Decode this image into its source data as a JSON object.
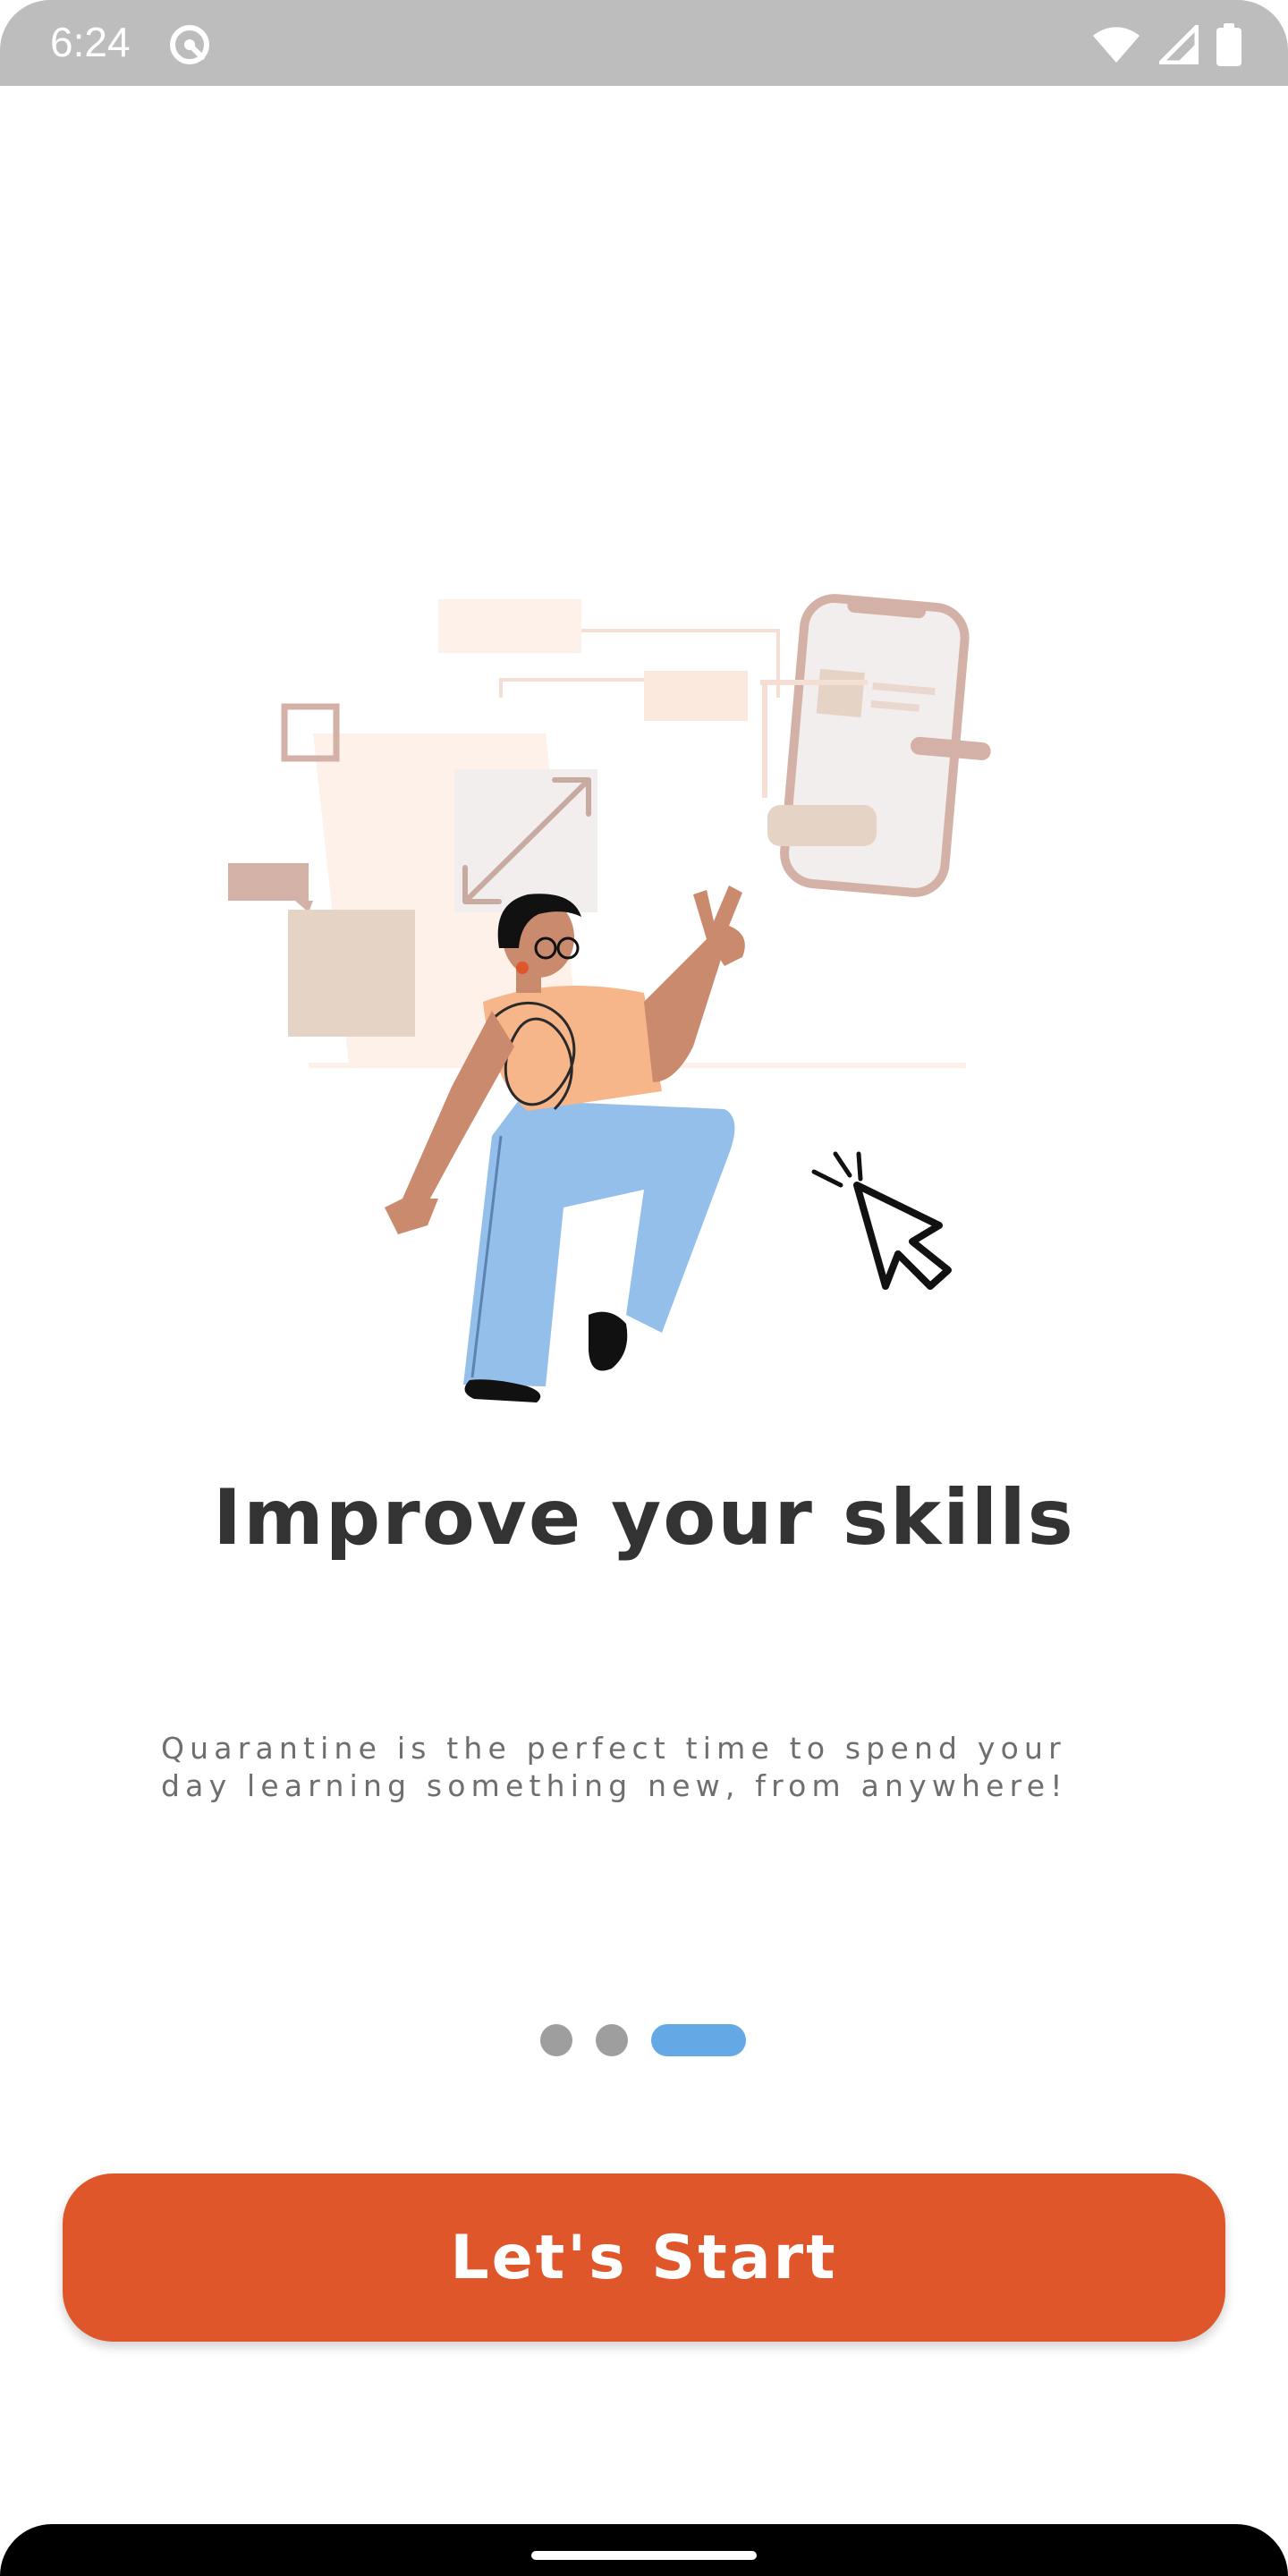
{
  "status_bar": {
    "time": "6:24",
    "icons": [
      "app-notification-icon",
      "wifi-icon",
      "cellular-signal-icon",
      "battery-icon"
    ]
  },
  "onboarding": {
    "illustration": "person-clicking-illustration",
    "title": "Improve your skills",
    "description": "Quarantine is the perfect time to spend your day learning something new, from anywhere!",
    "pager": {
      "total": 3,
      "active_index": 2
    },
    "cta_label": "Let's Start"
  },
  "colors": {
    "accent": "#e0562b",
    "pager_active": "#64a8e6",
    "pager_inactive": "#9e9e9e",
    "title": "#333333",
    "description": "#6e6e6e",
    "status_bar": "#bdbdbd"
  }
}
